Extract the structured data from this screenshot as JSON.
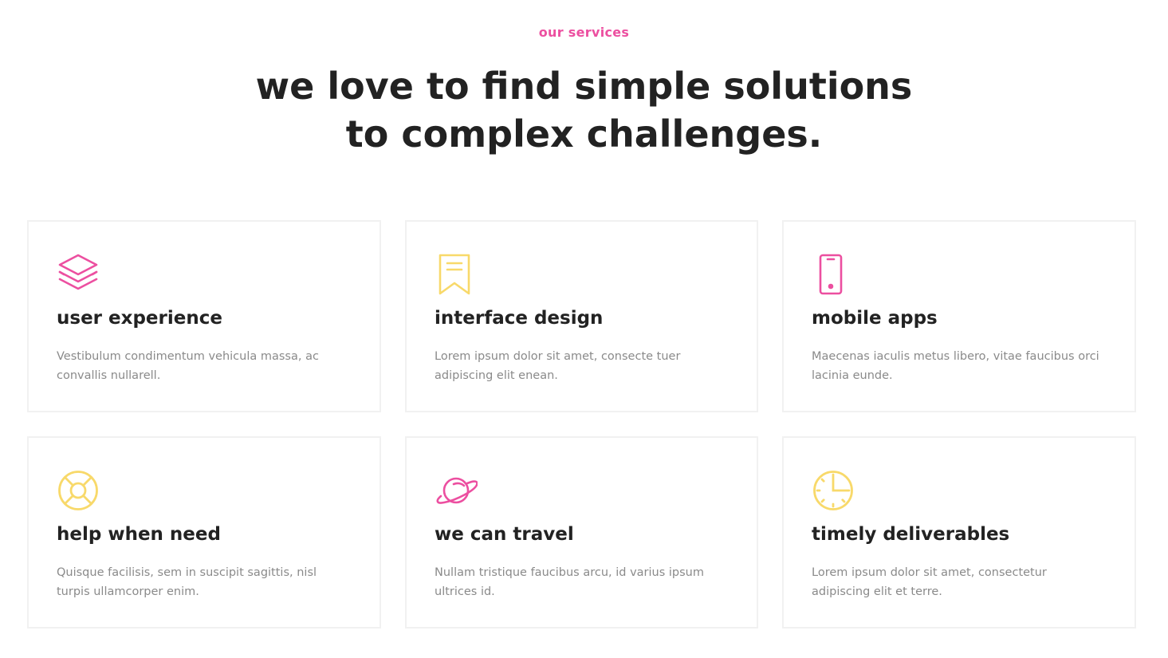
{
  "colors": {
    "accent_pink": "#ec4fa0",
    "accent_yellow": "#f8d96a",
    "heading": "#222222",
    "body_text": "#8a8a8a",
    "card_border": "#f1f1f1"
  },
  "header": {
    "eyebrow": "our services",
    "headline_line1": "we love to find simple solutions",
    "headline_line2": "to complex challenges."
  },
  "services": [
    {
      "icon": "layers-icon",
      "icon_color": "#ec4fa0",
      "title": "user experience",
      "description": "Vestibulum condimentum vehicula massa, ac convallis nullarell."
    },
    {
      "icon": "bookmark-icon",
      "icon_color": "#f8d96a",
      "title": "interface design",
      "description": "Lorem ipsum dolor sit amet, consecte tuer adipiscing elit enean."
    },
    {
      "icon": "smartphone-icon",
      "icon_color": "#ec4fa0",
      "title": "mobile apps",
      "description": "Maecenas iaculis metus libero, vitae faucibus orci lacinia eunde."
    },
    {
      "icon": "lifebuoy-icon",
      "icon_color": "#f8d96a",
      "title": "help when need",
      "description": "Quisque facilisis, sem in suscipit sagittis, nisl turpis ullamcorper enim."
    },
    {
      "icon": "planet-icon",
      "icon_color": "#ec4fa0",
      "title": "we can travel",
      "description": "Nullam tristique faucibus arcu, id varius ipsum ultrices id."
    },
    {
      "icon": "clock-icon",
      "icon_color": "#f8d96a",
      "title": "timely deliverables",
      "description": "Lorem ipsum dolor sit amet, consectetur adipiscing elit et terre."
    }
  ]
}
